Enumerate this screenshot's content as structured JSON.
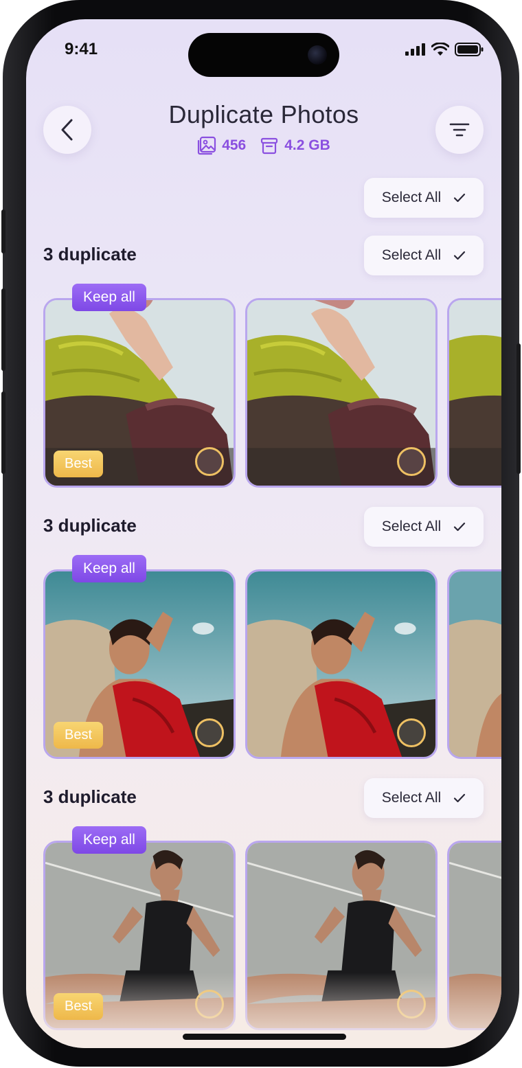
{
  "status_bar": {
    "time": "9:41"
  },
  "header": {
    "title": "Duplicate Photos",
    "photo_count": "456",
    "storage": "4.2 GB",
    "back_icon": "chevron-left-icon",
    "filter_icon": "filter-icon"
  },
  "select_all_top": {
    "label": "Select All"
  },
  "groups": [
    {
      "title": "3 duplicate",
      "select_label": "Select All",
      "keep_label": "Keep all",
      "best_label": "Best",
      "scene": "knitwear portrait"
    },
    {
      "title": "3 duplicate",
      "select_label": "Select All",
      "keep_label": "Keep all",
      "best_label": "Best",
      "scene": "red top against rock and sky"
    },
    {
      "title": "3 duplicate",
      "select_label": "Select All",
      "keep_label": "Keep all",
      "best_label": "Best",
      "scene": "black tank top on court"
    }
  ],
  "colors": {
    "accent": "#8a4fe0",
    "best": "#f0c05a",
    "card_border": "#b9a6ee"
  }
}
